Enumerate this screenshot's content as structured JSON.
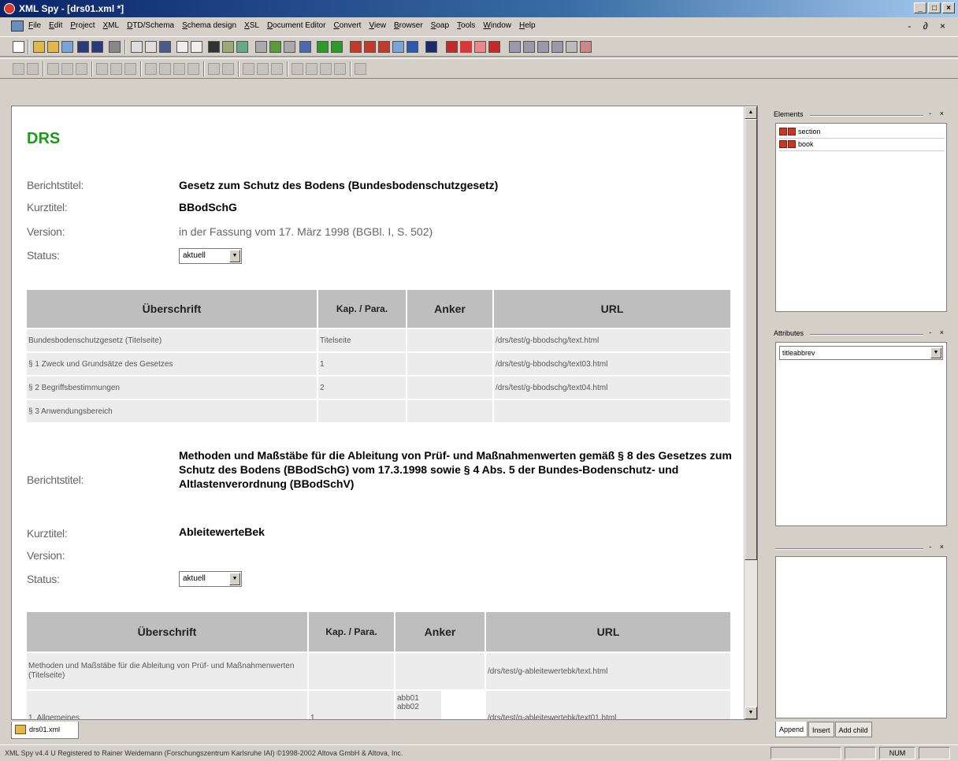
{
  "window": {
    "title": "XML Spy - [drs01.xml *]",
    "min": "_",
    "max": "□",
    "close": "×"
  },
  "menu": [
    "File",
    "Edit",
    "Project",
    "XML",
    "DTD/Schema",
    "Schema design",
    "XSL",
    "Document Editor",
    "Convert",
    "View",
    "Browser",
    "Soap",
    "Tools",
    "Window",
    "Help"
  ],
  "mdi_controls": "- ∂ ×",
  "doc": {
    "heading": "DRS",
    "labels": {
      "berichtstitel": "Berichtstitel:",
      "kurztitel": "Kurztitel:",
      "version": "Version:",
      "status": "Status:"
    },
    "report1": {
      "berichtstitel": "Gesetz zum Schutz des Bodens (Bundesbodenschutzgesetz)",
      "kurztitel": "BBodSchG",
      "version": "in der Fassung vom 17. März 1998 (BGBl. I, S. 502)",
      "status": "aktuell",
      "table": {
        "headers": [
          "Überschrift",
          "Kap. / Para.",
          "Anker",
          "URL"
        ],
        "rows": [
          [
            "Bundesbodenschutzgesetz (Titelseite)",
            "Titelseite",
            "",
            "/drs/test/g-bbodschg/text.html"
          ],
          [
            "§ 1 Zweck und Grundsätze des Gesetzes",
            "1",
            "",
            "/drs/test/g-bbodschg/text03.html"
          ],
          [
            "§ 2 Begriffsbestimmungen",
            "2",
            "",
            "/drs/test/g-bbodschg/text04.html"
          ],
          [
            "§ 3 Anwendungsbereich",
            "",
            "",
            ""
          ]
        ]
      }
    },
    "report2": {
      "berichtstitel": "Methoden und Maßstäbe für die Ableitung von Prüf- und Maßnahmenwerten gemäß § 8 des Gesetzes zum Schutz des Bodens (BBodSchG) vom 17.3.1998 sowie § 4 Abs. 5 der Bundes-Bodenschutz- und Altlastenverordnung (BBodSchV)",
      "kurztitel": "AbleitewerteBek",
      "version": "",
      "status": "aktuell",
      "table": {
        "headers": [
          "Überschrift",
          "Kap. / Para.",
          "Anker",
          "URL"
        ],
        "rows": [
          [
            "Methoden und Maßstäbe für die Ableitung von Prüf- und Maßnahmenwerten (Titelseite)",
            "",
            "",
            "/drs/test/g-ableitewertebk/text.html"
          ],
          [
            "1. Allgemeines",
            "1",
            "abb01 abb02",
            "/drs/test/g-ableitewertebk/text01.html"
          ]
        ]
      }
    }
  },
  "doc_tab": "drs01.xml",
  "panes": {
    "elements": {
      "title": "Elements",
      "items": [
        "section",
        "book"
      ]
    },
    "attributes": {
      "title": "Attributes",
      "selected": "titleabbrev"
    },
    "entry_helper": {
      "title": ""
    },
    "tabs": [
      "Append",
      "Insert",
      "Add child"
    ],
    "controls": "- ×"
  },
  "status": {
    "text": "XML Spy v4.4 U   Registered to Rainer Weidemann (Forschungszentrum Karlsruhe IAI)   ©1998-2002 Altova GmbH & Altova, Inc.",
    "num": "NUM"
  }
}
